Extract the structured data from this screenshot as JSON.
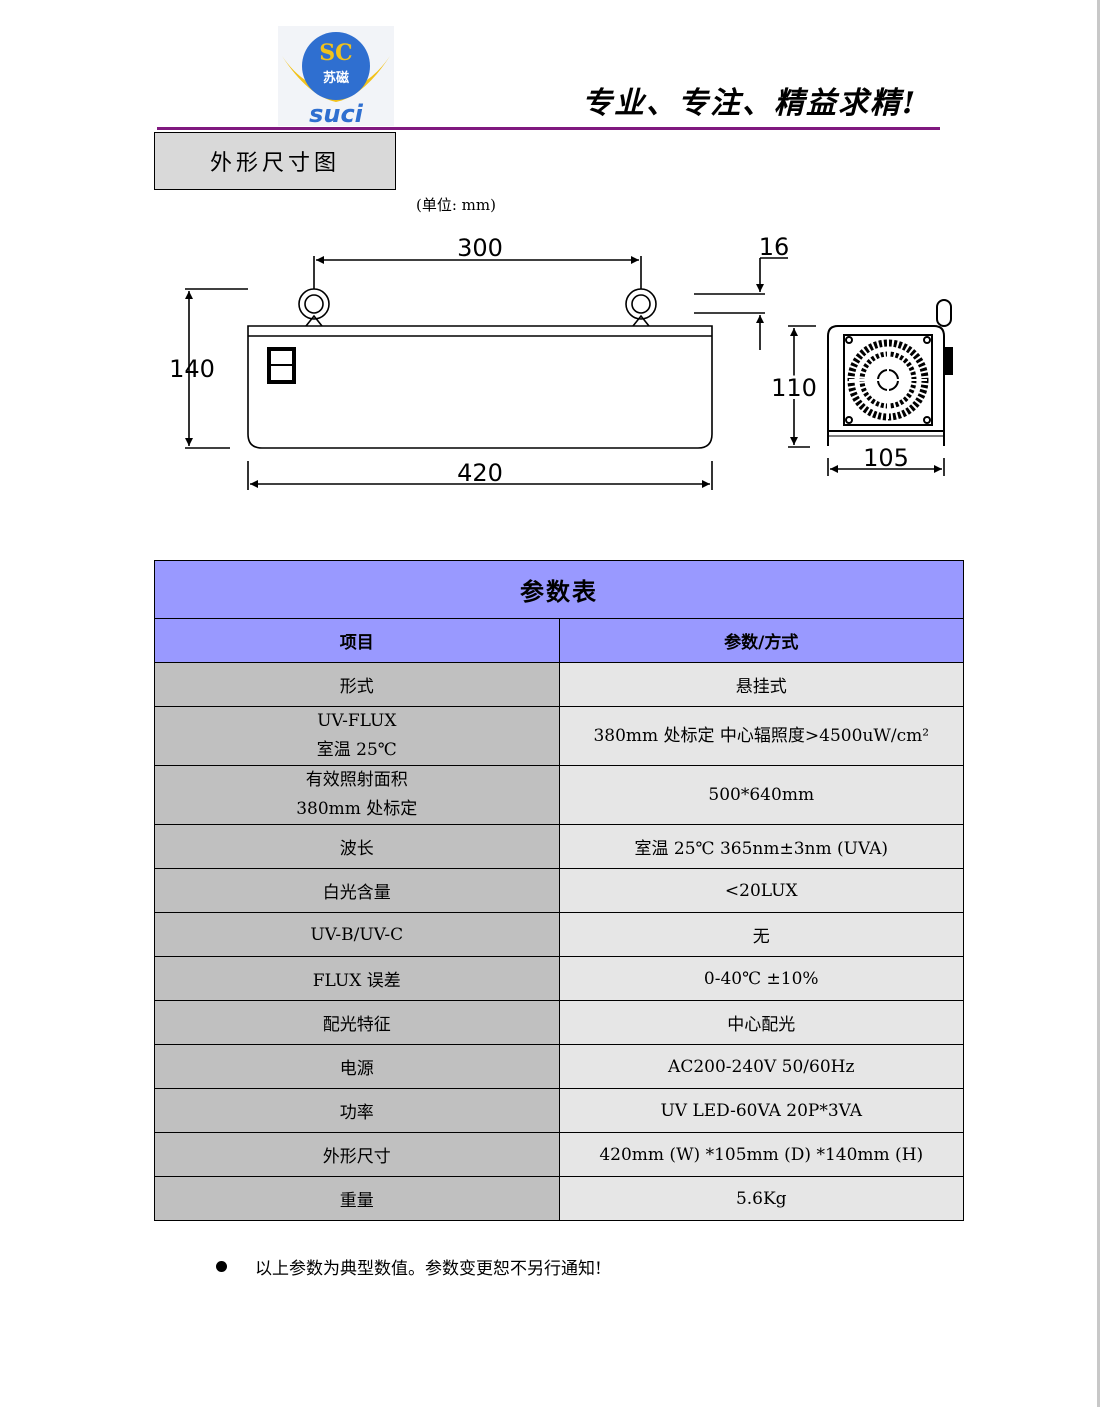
{
  "header": {
    "logo": {
      "letters": "SC",
      "cn": "苏磁",
      "brand": "suci",
      "colors": {
        "globe": "#2f6fd0",
        "ring": "#f2c21a",
        "text_brand": "#2f6fd0"
      }
    },
    "slogan": "专业、专注、精益求精!",
    "rule_color": "#80187f"
  },
  "section": {
    "title": "外形尺寸图",
    "unit_note": "(单位: mm)"
  },
  "drawing": {
    "front_view": {
      "width_label": "420",
      "height_label": "140",
      "eyebolt_spacing_label": "300"
    },
    "side_view": {
      "depth_label": "105",
      "body_height_label": "110",
      "eyebolt_height_label": "16"
    }
  },
  "table": {
    "title": "参数表",
    "header_color": "#9999ff",
    "item_color": "#c0c0c0",
    "value_color": "#e6e6e6",
    "columns": [
      "项目",
      "参数/方式"
    ],
    "rows": [
      {
        "item": [
          "形式"
        ],
        "value": "悬挂式"
      },
      {
        "item": [
          "UV-FLUX",
          "室温 25℃"
        ],
        "value": "380mm 处标定  中心辐照度>4500uW/cm²"
      },
      {
        "item": [
          "有效照射面积",
          "380mm 处标定"
        ],
        "value": "500*640mm"
      },
      {
        "item": [
          "波长"
        ],
        "value": "室温 25℃      365nm±3nm (UVA)"
      },
      {
        "item": [
          "白光含量"
        ],
        "value": "<20LUX"
      },
      {
        "item": [
          "UV-B/UV-C"
        ],
        "value": "无"
      },
      {
        "item": [
          "FLUX 误差"
        ],
        "value": "0-40℃   ±10%"
      },
      {
        "item": [
          "配光特征"
        ],
        "value": "中心配光"
      },
      {
        "item": [
          "电源"
        ],
        "value": "AC200-240V    50/60Hz"
      },
      {
        "item": [
          "功率"
        ],
        "value": "UV LED-60VA   20P*3VA"
      },
      {
        "item": [
          "外形尺寸"
        ],
        "value": "420mm (W) *105mm (D) *140mm (H)"
      },
      {
        "item": [
          "重量"
        ],
        "value": "5.6Kg"
      }
    ]
  },
  "footnote": "以上参数为典型数值。参数变更恕不另行通知!"
}
